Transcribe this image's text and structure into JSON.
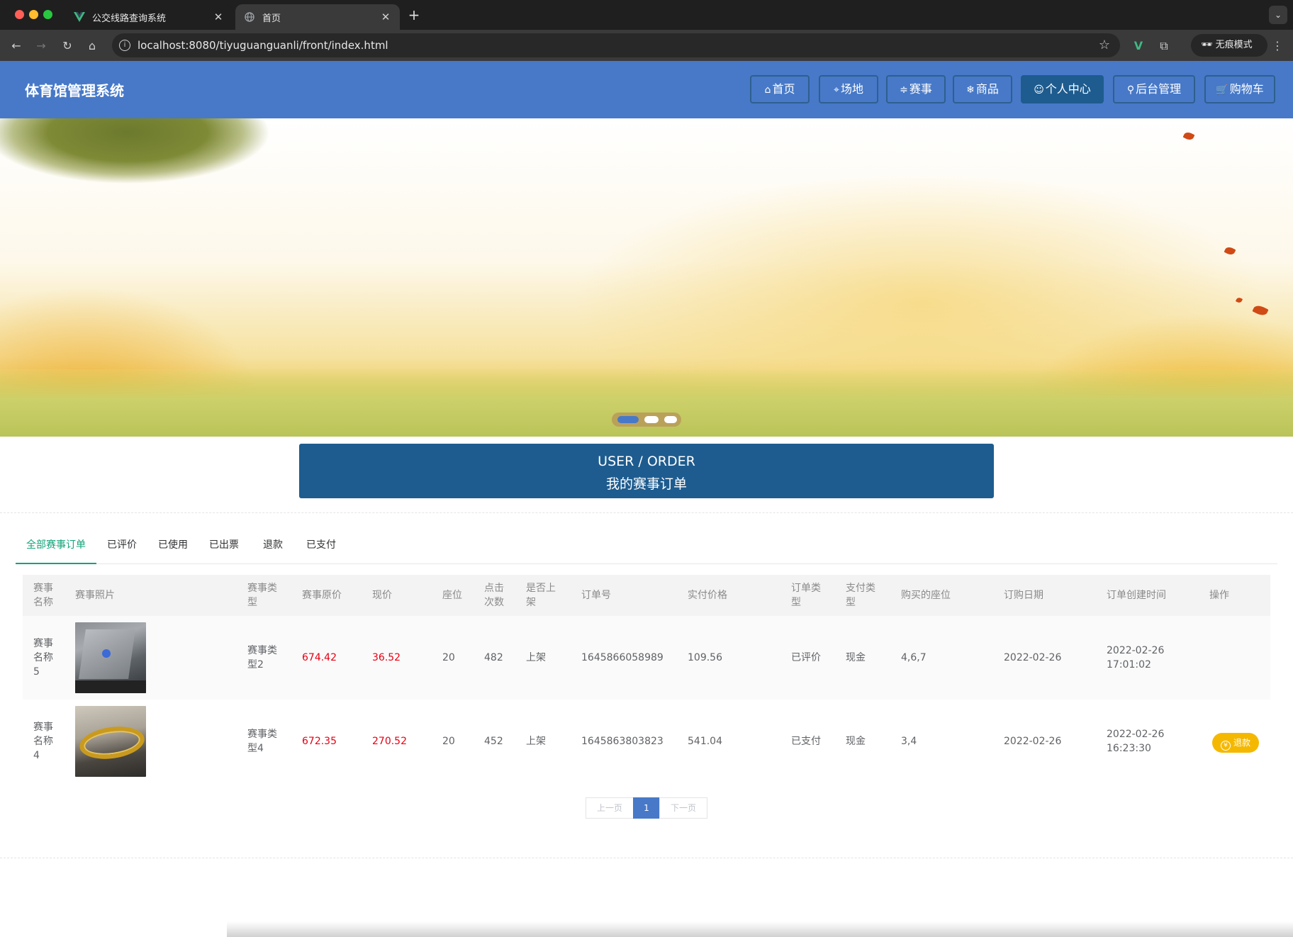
{
  "browser": {
    "tabs": [
      {
        "title": "公交线路查询系统",
        "icon": "vue-logo-icon",
        "active": false
      },
      {
        "title": "首页",
        "icon": "globe-icon",
        "active": true
      }
    ],
    "url": "localhost:8080/tiyuguanguanli/front/index.html",
    "incognito_label": "无痕模式"
  },
  "site": {
    "title": "体育馆管理系统",
    "menu": [
      {
        "label": "首页",
        "icon": "home-icon"
      },
      {
        "label": "场地",
        "icon": "tag-icon"
      },
      {
        "label": "赛事",
        "icon": "sliders-icon"
      },
      {
        "label": "商品",
        "icon": "snowflake-icon"
      },
      {
        "label": "个人中心",
        "icon": "user-icon",
        "active": true
      },
      {
        "label": "后台管理",
        "icon": "link-icon"
      },
      {
        "label": "购物车",
        "icon": "cart-icon"
      }
    ]
  },
  "banner": {
    "slides": 3,
    "active_slide": 1,
    "accent_color": "#4779c8"
  },
  "section": {
    "title_en": "USER / ORDER",
    "title_cn": "我的赛事订单"
  },
  "order_tabs": [
    {
      "label": "全部赛事订单",
      "active": true
    },
    {
      "label": "已评价"
    },
    {
      "label": "已使用"
    },
    {
      "label": "已出票"
    },
    {
      "label": "退款"
    },
    {
      "label": "已支付"
    }
  ],
  "table": {
    "headers": {
      "name": "赛事\n名称",
      "photo": "赛事照片",
      "type": "赛事类\n型",
      "orig_price": "赛事原价",
      "price": "现价",
      "seat": "座位",
      "clicks": "点击\n次数",
      "listed": "是否上\n架",
      "order_no": "订单号",
      "paid": "实付价格",
      "order_type": "订单类\n型",
      "pay_type": "支付类\n型",
      "seats_bought": "购买的座位",
      "order_date": "订购日期",
      "created": "订单创建时间",
      "action": "操作"
    },
    "rows": [
      {
        "name": "赛事\n名称\n5",
        "photo": "laptop-photo",
        "type": "赛事类\n型2",
        "orig_price": "674.42",
        "price": "36.52",
        "seat": "20",
        "clicks": "482",
        "listed": "上架",
        "order_no": "1645866058989",
        "paid": "109.56",
        "order_type": "已评价",
        "pay_type": "现金",
        "seats_bought": "4,6,7",
        "order_date": "2022-02-26",
        "created": "2022-02-26\n17:01:02",
        "action": ""
      },
      {
        "name": "赛事\n名称\n4",
        "photo": "gold-chain-photo",
        "type": "赛事类\n型4",
        "orig_price": "672.35",
        "price": "270.52",
        "seat": "20",
        "clicks": "452",
        "listed": "上架",
        "order_no": "1645863803823",
        "paid": "541.04",
        "order_type": "已支付",
        "pay_type": "现金",
        "seats_bought": "3,4",
        "order_date": "2022-02-26",
        "created": "2022-02-26\n16:23:30",
        "action": "退款"
      }
    ]
  },
  "pagination": {
    "prev": "上一页",
    "current": "1",
    "next": "下一页"
  }
}
